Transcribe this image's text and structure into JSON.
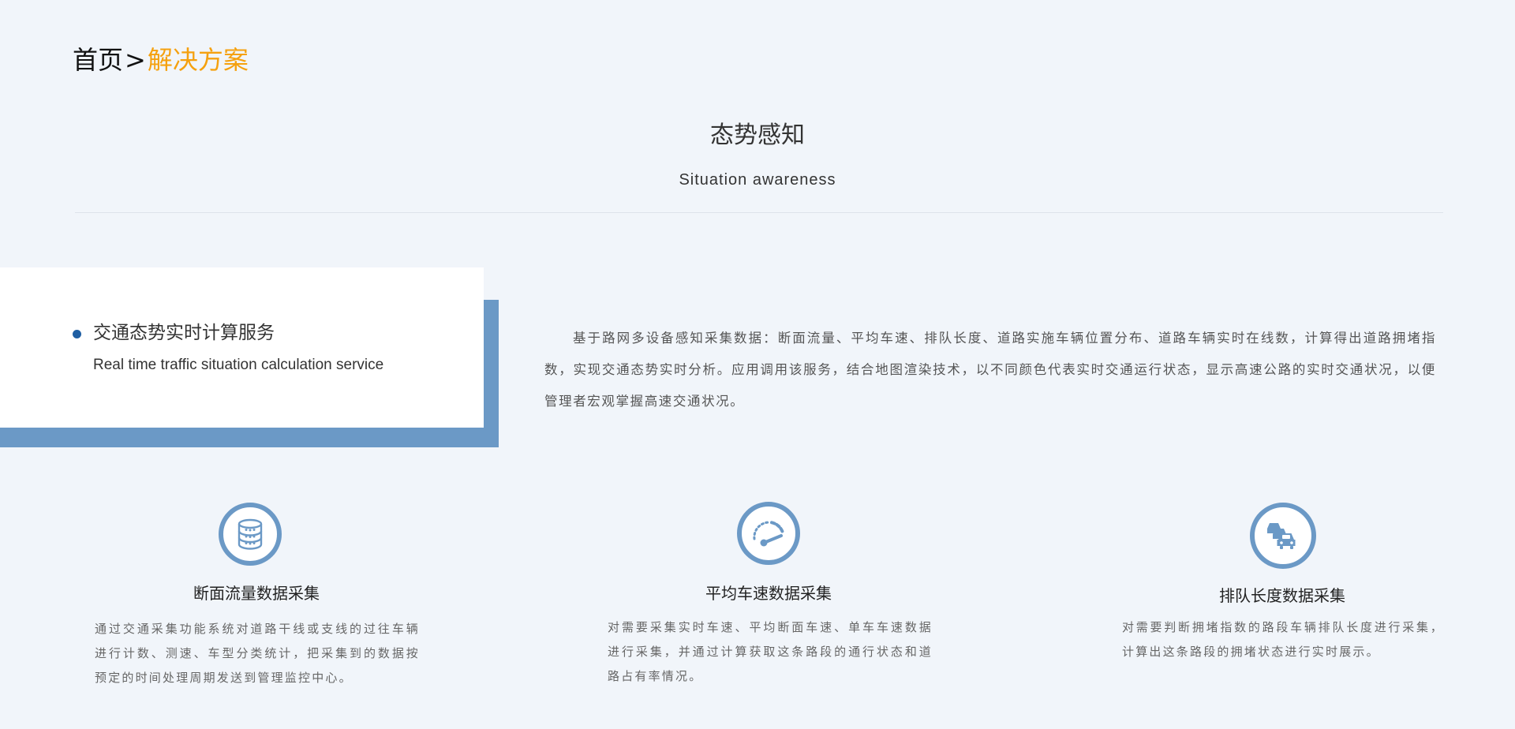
{
  "breadcrumb": {
    "home": "首页",
    "separator": ">",
    "current": "解决方案"
  },
  "section": {
    "title": "态势感知",
    "subtitle": "Situation awareness"
  },
  "feature": {
    "title": "交通态势实时计算服务",
    "title_en": "Real time traffic situation calculation service",
    "description": "基于路网多设备感知采集数据：断面流量、平均车速、排队长度、道路实施车辆位置分布、道路车辆实时在线数，计算得出道路拥堵指数，实现交通态势实时分析。应用调用该服务，结合地图渲染技术，以不同颜色代表实时交通运行状态，显示高速公路的实时交通状况，以便管理者宏观掌握高速交通状况。"
  },
  "cards": [
    {
      "icon": "database-icon",
      "title": "断面流量数据采集",
      "text": "通过交通采集功能系统对道路干线或支线的过往车辆进行计数、测速、车型分类统计，把采集到的数据按预定的时间处理周期发送到管理监控中心。"
    },
    {
      "icon": "speedometer-icon",
      "title": "平均车速数据采集",
      "text": "对需要采集实时车速、平均断面车速、单车车速数据进行采集，并通过计算获取这条路段的通行状态和道路占有率情况。"
    },
    {
      "icon": "traffic-queue-icon",
      "title": "排队长度数据采集",
      "text": "对需要判断拥堵指数的路段车辆排队长度进行采集，计算出这条路段的拥堵状态进行实时展示。"
    }
  ],
  "colors": {
    "accent": "#f5a10f",
    "brand_blue": "#6b99c6",
    "dot_blue": "#1f5fa3",
    "background": "#f1f5fa"
  }
}
